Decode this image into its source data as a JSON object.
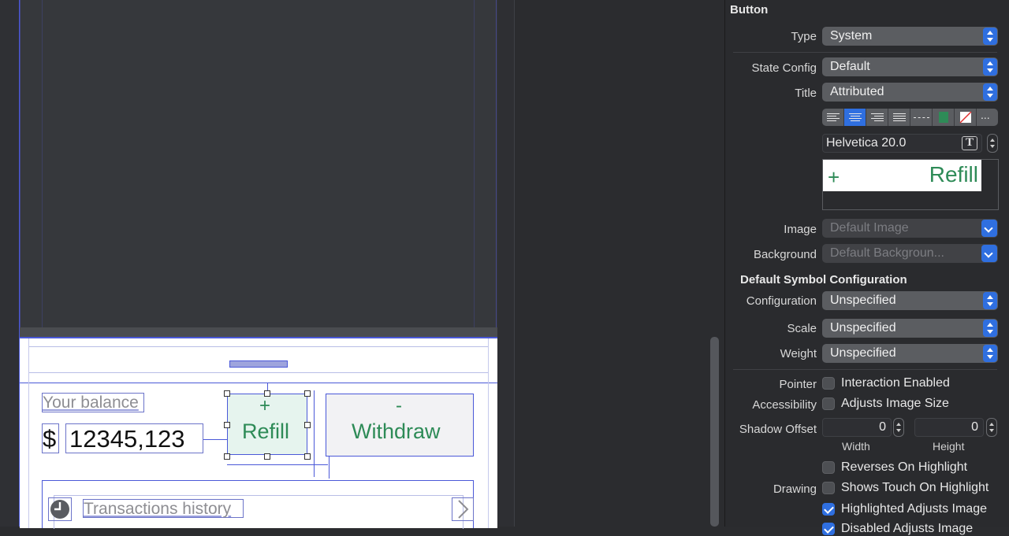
{
  "canvas": {
    "balance_label": "Your balance",
    "currency": "$",
    "amount": "12345,123",
    "refill_sign": "+",
    "refill_label": "Refill",
    "withdraw_sign": "-",
    "withdraw_label": "Withdraw",
    "history_label": "Transactions history",
    "chevron": "›"
  },
  "inspector": {
    "section_title": "Button",
    "type_label": "Type",
    "type_value": "System",
    "state_label": "State Config",
    "state_value": "Default",
    "title_label": "Title",
    "title_value": "Attributed",
    "font_value": "Helvetica 20.0",
    "preview_plus": "+",
    "preview_text": "Refill",
    "image_label": "Image",
    "image_placeholder": "Default Image",
    "background_label": "Background",
    "background_placeholder": "Default Backgroun...",
    "symbol_title": "Default Symbol Configuration",
    "configuration_label": "Configuration",
    "configuration_value": "Unspecified",
    "scale_label": "Scale",
    "scale_value": "Unspecified",
    "weight_label": "Weight",
    "weight_value": "Unspecified",
    "pointer_label": "Pointer",
    "pointer_option": "Interaction Enabled",
    "accessibility_label": "Accessibility",
    "accessibility_option": "Adjusts Image Size",
    "shadow_label": "Shadow Offset",
    "shadow_width": "0",
    "shadow_height": "0",
    "width_caption": "Width",
    "height_caption": "Height",
    "reverses_option": "Reverses On Highlight",
    "drawing_label": "Drawing",
    "shows_touch_option": "Shows Touch On Highlight",
    "highlighted_option": "Highlighted Adjusts Image",
    "disabled_option": "Disabled Adjusts Image",
    "more_glyph": "...",
    "font_icon": "T"
  },
  "colors": {
    "accent": "#2f6fe0",
    "green": "#2e8b57",
    "selection_blue": "#4a58d8"
  }
}
